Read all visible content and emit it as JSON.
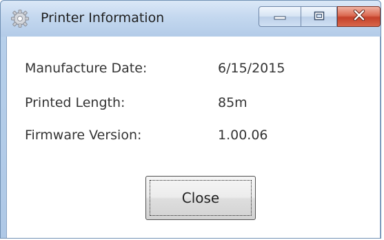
{
  "window": {
    "title": "Printer Information",
    "icon": "gear-icon"
  },
  "caption_buttons": {
    "minimize_icon": "minimize-icon",
    "maximize_icon": "maximize-icon",
    "close_icon": "close-icon",
    "close_color": "#c4412a"
  },
  "info": {
    "rows": [
      {
        "label": "Manufacture Date:",
        "value": "6/15/2015"
      },
      {
        "label": "Printed Length:",
        "value": "85m"
      },
      {
        "label": "Firmware Version:",
        "value": "1.00.06"
      }
    ]
  },
  "dialog": {
    "close_label": "Close"
  }
}
